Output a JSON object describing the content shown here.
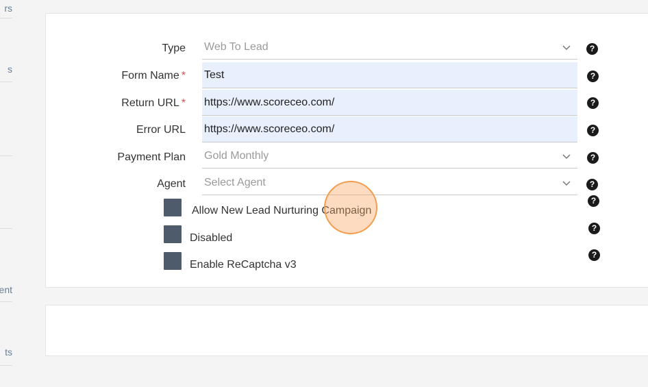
{
  "sidebar": {
    "fragments": [
      "rs",
      "s",
      "ent",
      "ts"
    ]
  },
  "form": {
    "type": {
      "label": "Type",
      "value": "Web To Lead"
    },
    "form_name": {
      "label": "Form Name",
      "required_mark": "*",
      "value": "Test"
    },
    "return_url": {
      "label": "Return URL",
      "required_mark": "*",
      "value": "https://www.scoreceo.com/"
    },
    "error_url": {
      "label": "Error URL",
      "value": "https://www.scoreceo.com/"
    },
    "payment_plan": {
      "label": "Payment Plan",
      "value": "Gold Monthly"
    },
    "agent": {
      "label": "Agent",
      "placeholder": "Select Agent"
    },
    "checkboxes": [
      {
        "label": "Allow New Lead Nurturing Campaign"
      },
      {
        "label": "Disabled"
      },
      {
        "label": "Enable ReCaptcha v3"
      }
    ],
    "help_glyph": "?"
  },
  "colors": {
    "page_bg": "#f4f4f4",
    "input_autofill_bg": "#e8f0fe",
    "required_star": "#d9534f",
    "checkbox_fill": "#4e5b6b",
    "cursor_highlight": "#f39c4a"
  },
  "icons": {
    "select_caret": "chevron-down-icon",
    "help": "question-circle-icon"
  }
}
